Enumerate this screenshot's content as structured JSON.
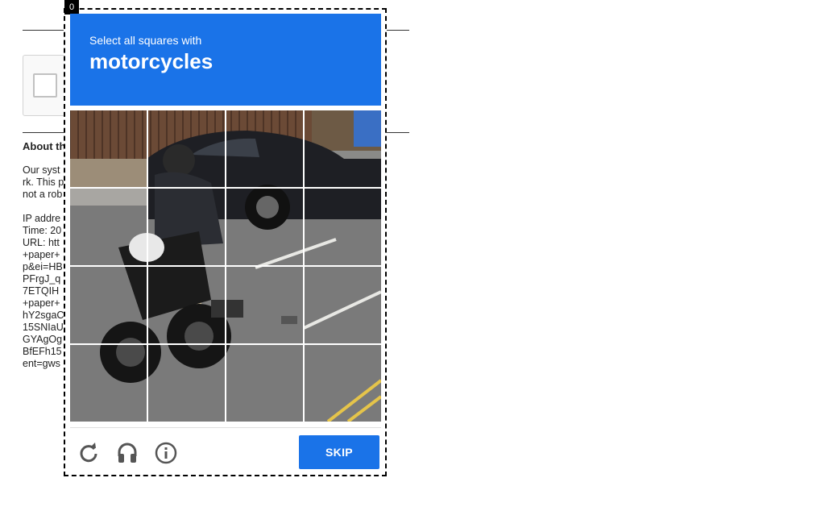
{
  "background": {
    "about_title": "About th",
    "lines": [
      "Our syst",
      "rk. This p",
      "not a rob",
      "",
      "IP addre",
      "Time: 20",
      "URL: htt",
      "+paper+",
      "p&ei=HB",
      "PFrgJ_q",
      "7ETQIH",
      "+paper+",
      "hY2sgaC",
      "15SNIaU",
      "GYAgOg",
      "BfEFh15",
      "ent=gws"
    ]
  },
  "challenge": {
    "index_badge": "0",
    "instruction": "Select all squares with",
    "target": "motorcycles",
    "skip_label": "SKIP",
    "grid_rows": 4,
    "grid_cols": 4,
    "accent_color": "#1a73e8"
  },
  "icons": {
    "reload": "reload-icon",
    "audio": "headphones-icon",
    "info": "info-icon"
  }
}
